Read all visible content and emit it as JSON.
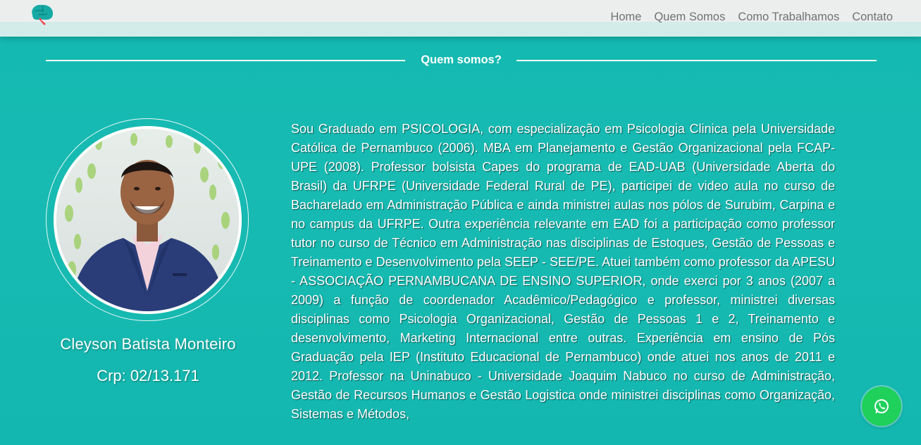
{
  "header": {
    "nav": [
      "Home",
      "Quem Somos",
      "Como Trabalhamos",
      "Contato"
    ]
  },
  "section": {
    "title": "Quem somos?"
  },
  "profile": {
    "name": "Cleyson Batista Monteiro",
    "crp": "Crp: 02/13.171"
  },
  "bio": {
    "text": "Sou Graduado em PSICOLOGIA, com especialização em Psicologia Clinica pela Universidade Católica de Pernambuco (2006). MBA em Planejamento e Gestão Organizacional pela FCAP-UPE (2008). Professor bolsista Capes do programa de EAD-UAB (Universidade Aberta do Brasil) da UFRPE (Universidade Federal Rural de PE), participei de video aula no curso de Bacharelado em Administração Pública e ainda ministrei aulas nos pólos de Surubim, Carpina e no campus da UFRPE. Outra experiência relevante em EAD foi a participação como professor tutor no curso de Técnico em Administração nas disciplinas de Estoques, Gestão de Pessoas e Treinamento e Desenvolvimento pela SEEP - SEE/PE. Atuei também como professor da APESU - ASSOCIAÇÃO PERNAMBUCANA DE ENSINO SUPERIOR, onde exerci por 3 anos (2007 a 2009) a função de coordenador Acadêmico/Pedagógico e professor, ministrei diversas disciplinas como Psicologia Organizacional, Gestão de Pessoas 1 e 2, Treinamento e desenvolvimento, Marketing Internacional entre outras. Experiência em ensino de Pós Graduação pela IEP (Instituto Educacional de Pernambuco) onde atuei nos anos de 2011 e 2012. Professor na Uninabuco - Universidade Joaquim Nabuco no curso de Administração, Gestão de Recursos Humanos e Gestão Logistica onde ministrei disciplinas como Organização, Sistemas e Métodos,"
  },
  "icons": {
    "logo": "brain-logo-icon",
    "whatsapp": "whatsapp-icon"
  },
  "colors": {
    "background": "#13b7af",
    "header": "#eceeee",
    "nav_text": "#6f7173",
    "whatsapp": "#1fd05b"
  }
}
